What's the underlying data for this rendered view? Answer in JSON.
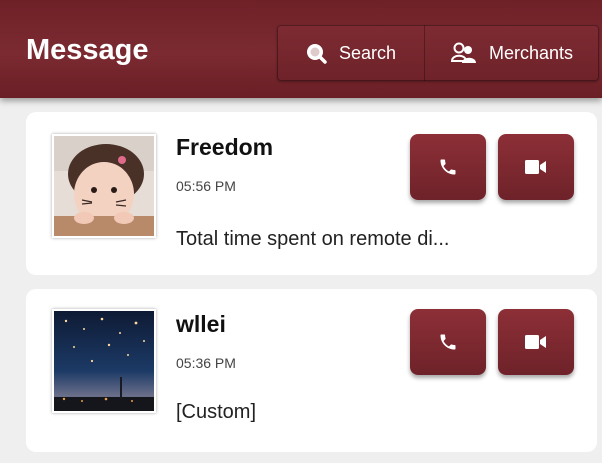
{
  "header": {
    "title": "Message",
    "search_label": "Search",
    "merchants_label": "Merchants"
  },
  "conversations": [
    {
      "name": "Freedom",
      "time": "05:56 PM",
      "preview": "Total time spent on remote di..."
    },
    {
      "name": "wllei",
      "time": "05:36 PM",
      "preview": "[Custom]"
    }
  ],
  "icons": {
    "search": "search-icon",
    "merchants": "users-icon",
    "call": "phone-icon",
    "video": "video-camera-icon"
  },
  "colors": {
    "brand": "#7a2930",
    "background": "#efefef",
    "card": "#ffffff"
  }
}
